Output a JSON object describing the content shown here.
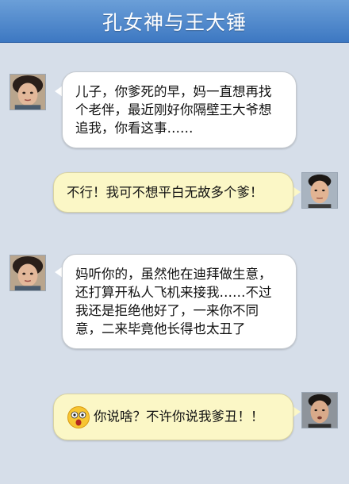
{
  "header": {
    "title": "孔女神与王大锤"
  },
  "messages": [
    {
      "side": "left",
      "sender_icon": "mother-avatar",
      "text": "儿子，你爹死的早，妈一直想再找个老伴，最近刚好你隔壁王大爷想追我，你看这事……"
    },
    {
      "side": "right",
      "sender_icon": "son-avatar",
      "text": "不行！我可不想平白无故多个爹！"
    },
    {
      "side": "left",
      "sender_icon": "mother-avatar",
      "text": "妈听你的，虽然他在迪拜做生意，还打算开私人飞机来接我……不过我还是拒绝他好了，一来你不同意，二来毕竟他长得也太丑了"
    },
    {
      "side": "right",
      "sender_icon": "son-avatar",
      "emoji": "shocked-face-icon",
      "text": "你说啥？不许你说我爹丑！！"
    }
  ],
  "colors": {
    "background": "#d6dee9",
    "header": "#4a83c8",
    "bubble_left": "#ffffff",
    "bubble_right": "#fbf7c6"
  }
}
